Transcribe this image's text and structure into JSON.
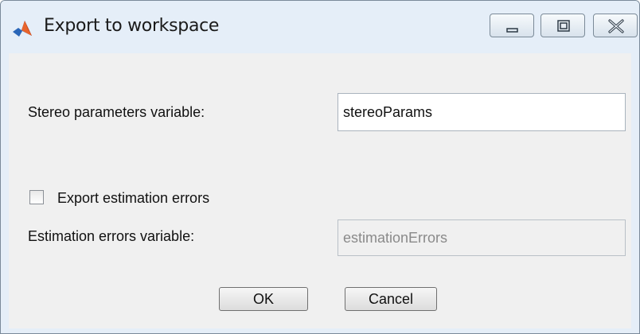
{
  "window": {
    "title": "Export to workspace",
    "icon": "matlab-icon",
    "controls": [
      "minimize-icon",
      "maximize-icon",
      "close-icon"
    ]
  },
  "form": {
    "stereo_label": "Stereo parameters variable:",
    "stereo_value": "stereoParams",
    "export_errors_label": "Export estimation errors",
    "export_errors_checked": false,
    "errors_label": "Estimation errors variable:",
    "errors_value": "estimationErrors",
    "errors_field_disabled": true
  },
  "buttons": {
    "ok": "OK",
    "cancel": "Cancel"
  }
}
